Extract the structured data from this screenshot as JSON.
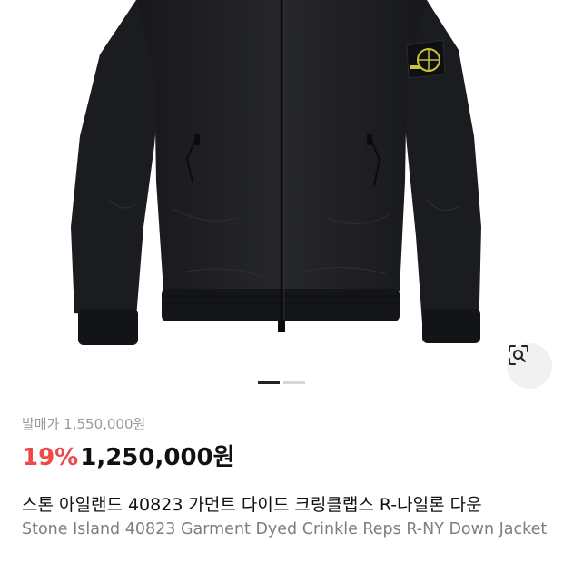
{
  "product": {
    "image_alt": "jacket product photo",
    "original_price_label": "발매가 1,550,000원",
    "discount": "19%",
    "price": "1,250,000원",
    "title_ko": "스톤 아일랜드 40823 가먼트 다이드 크링클랩스 R-나일론 다운",
    "title_en": "Stone Island 40823 Garment Dyed Crinkle Reps R-NY Down Jacket"
  },
  "gallery": {
    "slide_count": 2,
    "active_slide": 1,
    "lens_icon": "image-search-icon"
  },
  "colors": {
    "discount": "#f04848",
    "price": "#111111",
    "muted": "#9a9a9a",
    "jacket": "#1c1d21"
  }
}
